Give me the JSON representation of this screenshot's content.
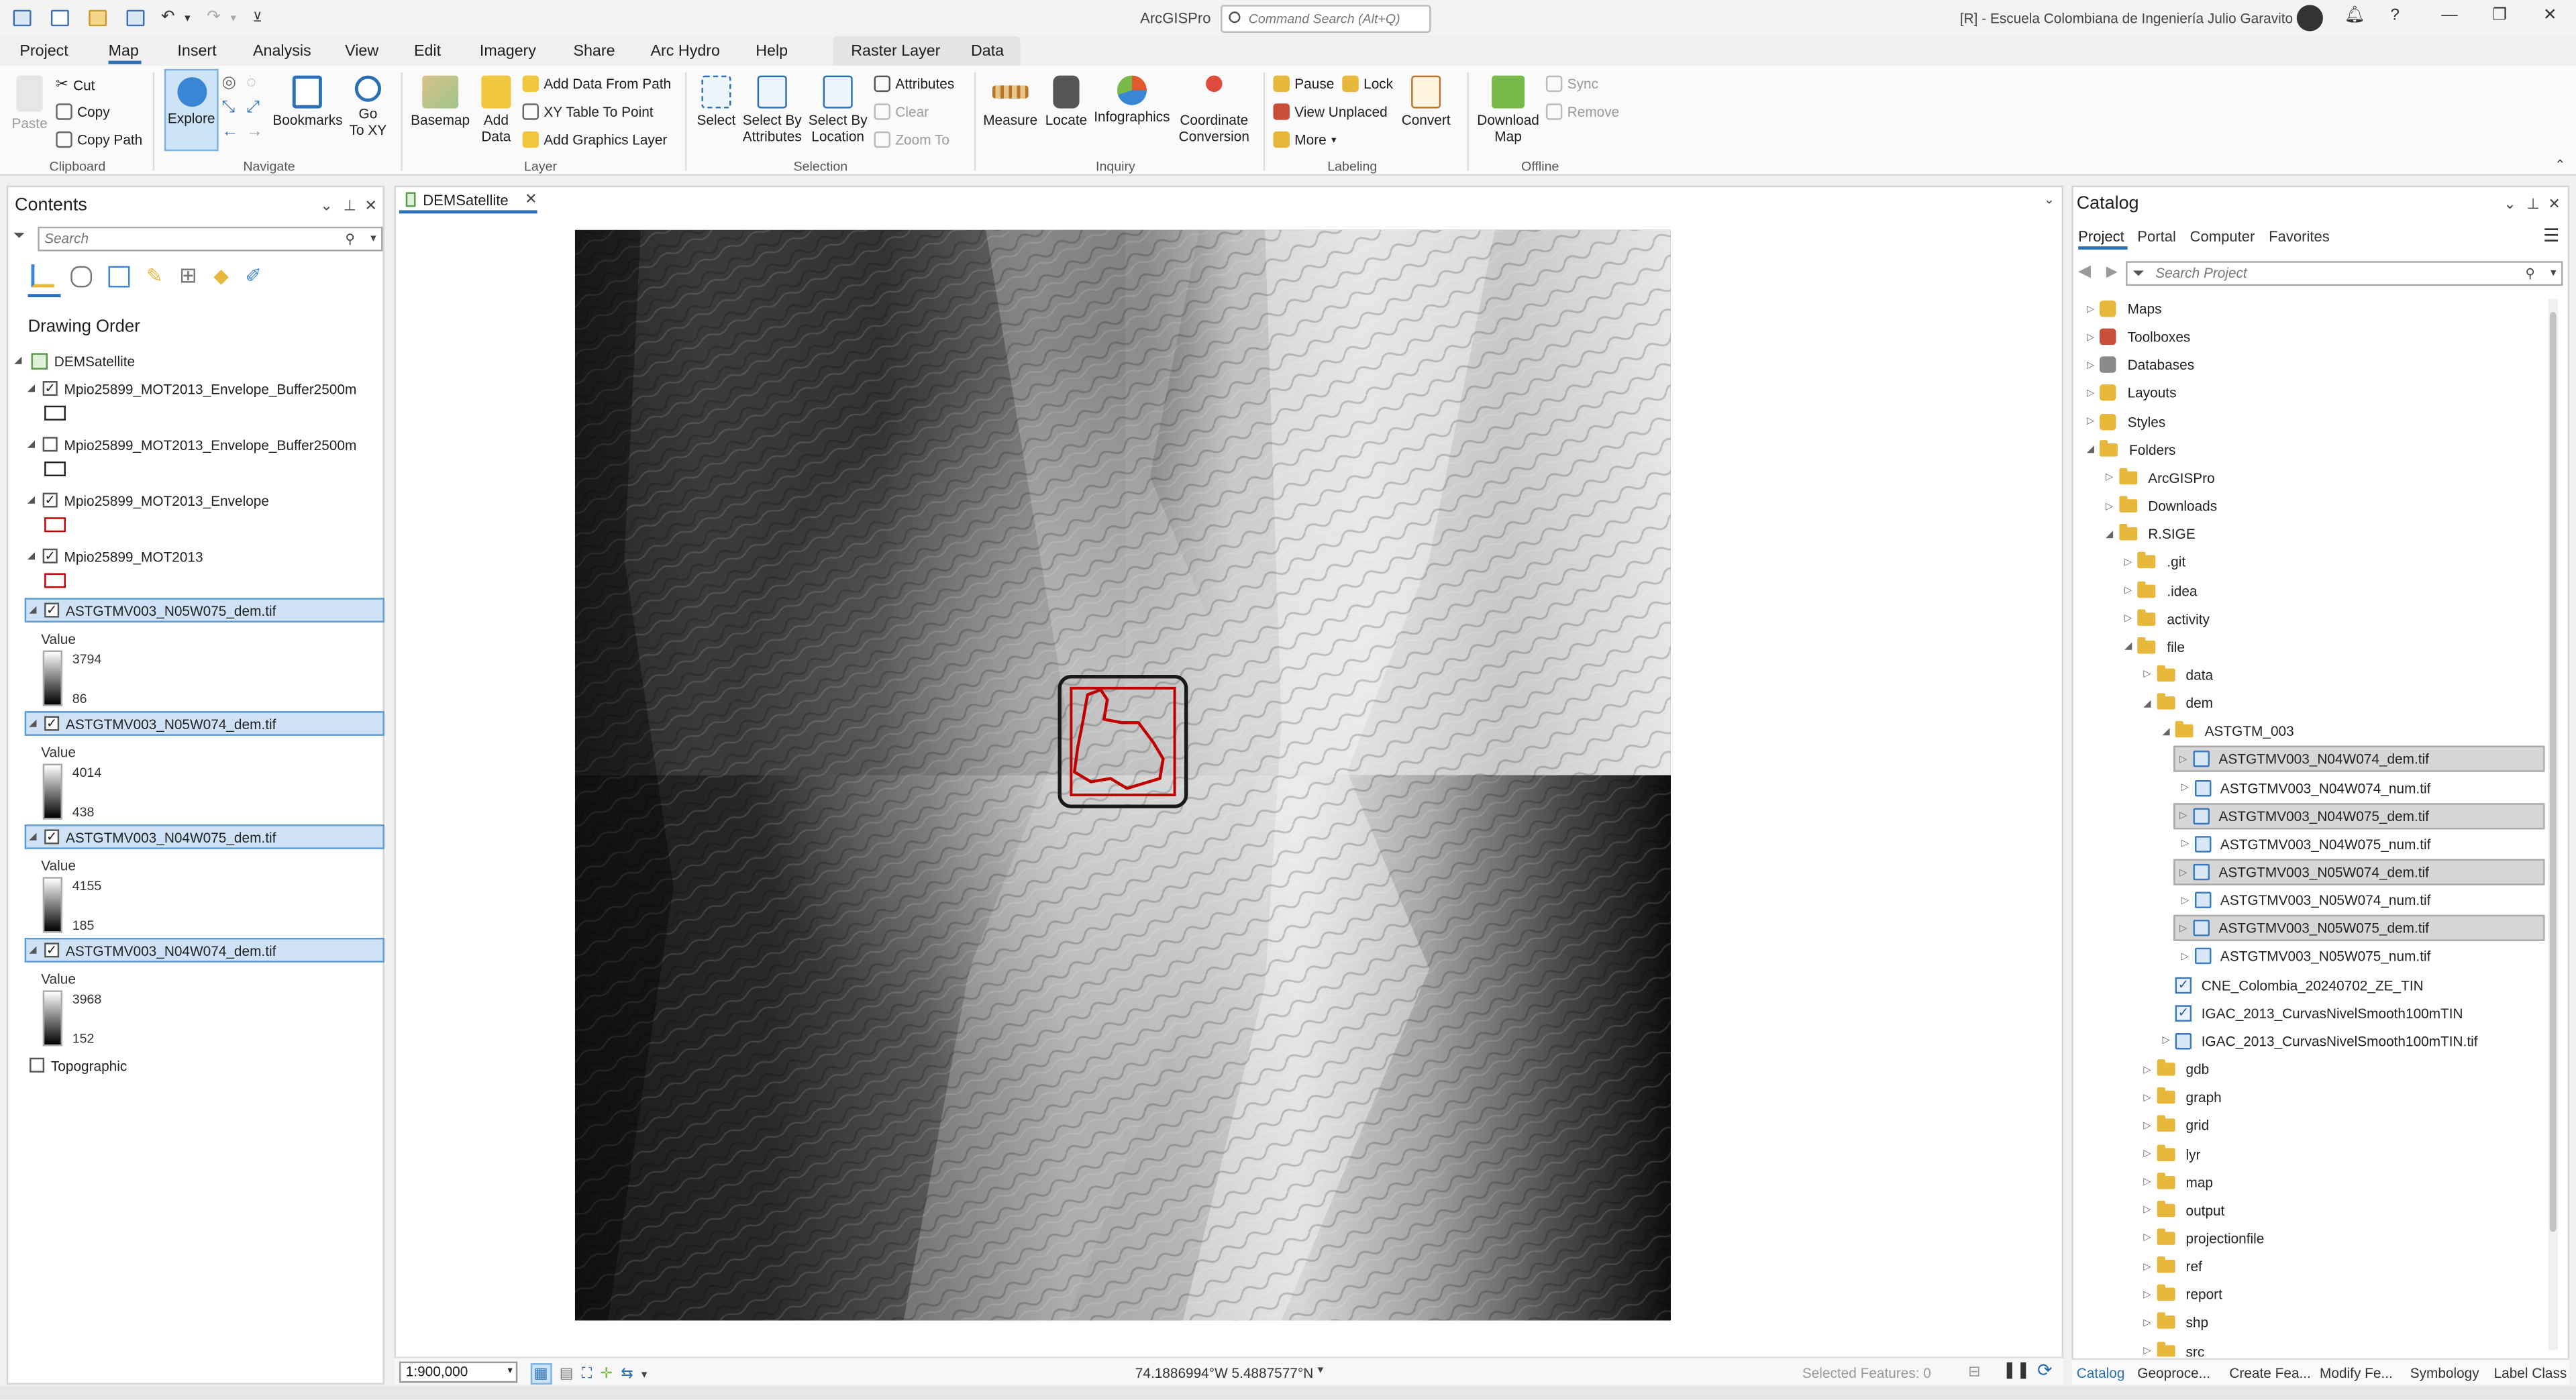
{
  "app": {
    "title": "ArcGISPro",
    "command_search": {
      "placeholder": "Command Search (Alt+Q)"
    },
    "org": "[R] - Escuela Colombiana de Ingeniería Julio Garavito"
  },
  "menu": {
    "tabs": [
      "Project",
      "Map",
      "Insert",
      "Analysis",
      "View",
      "Edit",
      "Imagery",
      "Share",
      "Arc Hydro",
      "Help"
    ],
    "active_tab": "Map",
    "context_tabs": [
      "Raster Layer",
      "Data"
    ]
  },
  "ribbon": {
    "clipboard": {
      "label": "Clipboard",
      "paste": "Paste",
      "cut": "Cut",
      "copy": "Copy",
      "copy_path": "Copy Path"
    },
    "navigate": {
      "label": "Navigate",
      "explore": "Explore",
      "bookmarks": "Bookmarks",
      "go_to_xy_1": "Go",
      "go_to_xy_2": "To XY"
    },
    "layer": {
      "label": "Layer",
      "basemap": "Basemap",
      "add_data_1": "Add",
      "add_data_2": "Data",
      "add_data_from_path": "Add Data From Path",
      "xy_table": "XY Table To Point",
      "add_graphics": "Add Graphics Layer"
    },
    "selection": {
      "label": "Selection",
      "select": "Select",
      "select_by_attr_1": "Select By",
      "select_by_attr_2": "Attributes",
      "select_by_loc_1": "Select By",
      "select_by_loc_2": "Location",
      "attributes": "Attributes",
      "clear": "Clear",
      "zoom_to": "Zoom To"
    },
    "inquiry": {
      "label": "Inquiry",
      "measure": "Measure",
      "locate": "Locate",
      "infographics": "Infographics",
      "coord_conv_1": "Coordinate",
      "coord_conv_2": "Conversion"
    },
    "labeling": {
      "label": "Labeling",
      "pause": "Pause",
      "lock": "Lock",
      "view_unplaced": "View Unplaced",
      "more": "More",
      "convert": "Convert"
    },
    "offline": {
      "label": "Offline",
      "download_1": "Download",
      "download_2": "Map",
      "sync": "Sync",
      "remove": "Remove"
    }
  },
  "contents": {
    "title": "Contents",
    "search_placeholder": "Search",
    "drawing_order": "Drawing Order",
    "map_name": "DEMSatellite",
    "layers": [
      {
        "name": "Mpio25899_MOT2013_Envelope_Buffer2500m",
        "checked": true
      },
      {
        "name": "Mpio25899_MOT2013_Envelope_Buffer2500m",
        "checked": false
      },
      {
        "name": "Mpio25899_MOT2013_Envelope",
        "checked": true
      },
      {
        "name": "Mpio25899_MOT2013",
        "checked": true
      }
    ],
    "rasters": [
      {
        "name": "ASTGTMV003_N05W075_dem.tif",
        "value_label": "Value",
        "high": "3794",
        "low": "86"
      },
      {
        "name": "ASTGTMV003_N05W074_dem.tif",
        "value_label": "Value",
        "high": "4014",
        "low": "438"
      },
      {
        "name": "ASTGTMV003_N04W075_dem.tif",
        "value_label": "Value",
        "high": "4155",
        "low": "185"
      },
      {
        "name": "ASTGTMV003_N04W074_dem.tif",
        "value_label": "Value",
        "high": "3968",
        "low": "152"
      }
    ],
    "basemap": "Topographic"
  },
  "map": {
    "tab_name": "DEMSatellite",
    "scale": "1:900,000",
    "coordinates": "74.1886994°W 5.4887577°N",
    "selected_features": "Selected Features: 0"
  },
  "catalog": {
    "title": "Catalog",
    "tabs": [
      "Project",
      "Portal",
      "Computer",
      "Favorites"
    ],
    "search_placeholder": "Search Project",
    "tree": [
      {
        "label": "Maps",
        "depth": 0,
        "icon": "maps-icon"
      },
      {
        "label": "Toolboxes",
        "depth": 0,
        "icon": "toolbox-icon"
      },
      {
        "label": "Databases",
        "depth": 0,
        "icon": "database-icon"
      },
      {
        "label": "Layouts",
        "depth": 0,
        "icon": "layout-icon"
      },
      {
        "label": "Styles",
        "depth": 0,
        "icon": "style-icon"
      },
      {
        "label": "Folders",
        "depth": 0,
        "icon": "folder-icon"
      },
      {
        "label": "ArcGISPro",
        "depth": 1,
        "icon": "folder-icon"
      },
      {
        "label": "Downloads",
        "depth": 1,
        "icon": "folder-icon"
      },
      {
        "label": "R.SIGE",
        "depth": 1,
        "icon": "folder-icon"
      },
      {
        "label": ".git",
        "depth": 2,
        "icon": "folder-icon"
      },
      {
        "label": ".idea",
        "depth": 2,
        "icon": "folder-icon"
      },
      {
        "label": "activity",
        "depth": 2,
        "icon": "folder-icon"
      },
      {
        "label": "file",
        "depth": 2,
        "icon": "folder-icon"
      },
      {
        "label": "data",
        "depth": 3,
        "icon": "folder-icon"
      },
      {
        "label": "dem",
        "depth": 3,
        "icon": "folder-icon"
      },
      {
        "label": "ASTGTM_003",
        "depth": 4,
        "icon": "folder-icon"
      },
      {
        "label": "ASTGTMV003_N04W074_dem.tif",
        "depth": 5,
        "icon": "raster-icon",
        "selected": true
      },
      {
        "label": "ASTGTMV003_N04W074_num.tif",
        "depth": 5,
        "icon": "raster-icon"
      },
      {
        "label": "ASTGTMV003_N04W075_dem.tif",
        "depth": 5,
        "icon": "raster-icon",
        "selected": true
      },
      {
        "label": "ASTGTMV003_N04W075_num.tif",
        "depth": 5,
        "icon": "raster-icon"
      },
      {
        "label": "ASTGTMV003_N05W074_dem.tif",
        "depth": 5,
        "icon": "raster-icon",
        "selected": true
      },
      {
        "label": "ASTGTMV003_N05W074_num.tif",
        "depth": 5,
        "icon": "raster-icon"
      },
      {
        "label": "ASTGTMV003_N05W075_dem.tif",
        "depth": 5,
        "icon": "raster-icon",
        "selected": true
      },
      {
        "label": "ASTGTMV003_N05W075_num.tif",
        "depth": 5,
        "icon": "raster-icon"
      },
      {
        "label": "CNE_Colombia_20240702_ZE_TIN",
        "depth": 4,
        "icon": "tin-icon"
      },
      {
        "label": "IGAC_2013_CurvasNivelSmooth100mTIN",
        "depth": 4,
        "icon": "tin-icon"
      },
      {
        "label": "IGAC_2013_CurvasNivelSmooth100mTIN.tif",
        "depth": 4,
        "icon": "raster-icon"
      },
      {
        "label": "gdb",
        "depth": 3,
        "icon": "folder-icon"
      },
      {
        "label": "graph",
        "depth": 3,
        "icon": "folder-icon"
      },
      {
        "label": "grid",
        "depth": 3,
        "icon": "folder-icon"
      },
      {
        "label": "lyr",
        "depth": 3,
        "icon": "folder-icon"
      },
      {
        "label": "map",
        "depth": 3,
        "icon": "folder-icon"
      },
      {
        "label": "output",
        "depth": 3,
        "icon": "folder-icon"
      },
      {
        "label": "projectionfile",
        "depth": 3,
        "icon": "folder-icon"
      },
      {
        "label": "ref",
        "depth": 3,
        "icon": "folder-icon"
      },
      {
        "label": "report",
        "depth": 3,
        "icon": "folder-icon"
      },
      {
        "label": "shp",
        "depth": 3,
        "icon": "folder-icon"
      },
      {
        "label": "src",
        "depth": 3,
        "icon": "folder-icon"
      }
    ],
    "bottom_tabs": [
      "Catalog",
      "Geoproce...",
      "Create Fea...",
      "Modify Fe...",
      "Symbology",
      "Label Class"
    ]
  },
  "colors": {
    "accent": "#2b6fb5",
    "selection": "#cfe2f5",
    "boundary_red": "#c00000"
  }
}
